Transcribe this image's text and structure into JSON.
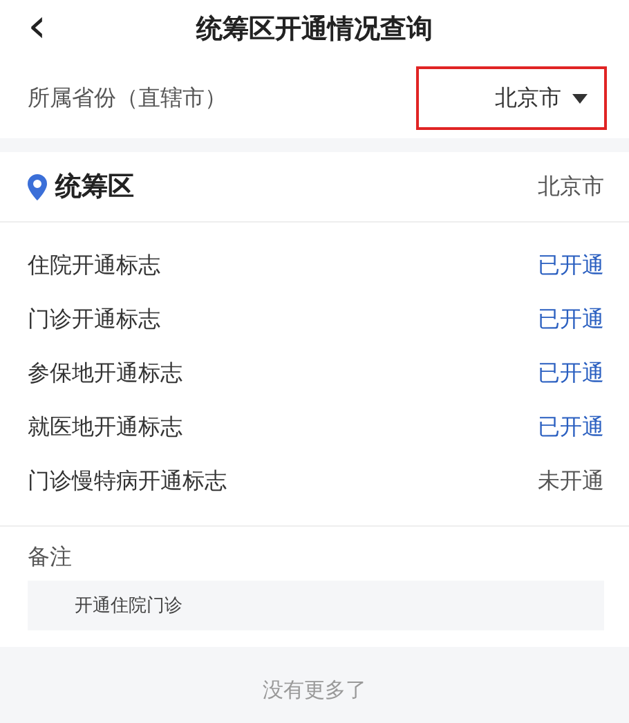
{
  "header": {
    "back": "‹",
    "title": "统筹区开通情况查询"
  },
  "province": {
    "label": "所属省份（直辖市）",
    "value": "北京市",
    "highlighted": true
  },
  "region": {
    "title": "统筹区",
    "value": "北京市"
  },
  "flags": [
    {
      "label": "住院开通标志",
      "status": "已开通",
      "open": true
    },
    {
      "label": "门诊开通标志",
      "status": "已开通",
      "open": true
    },
    {
      "label": "参保地开通标志",
      "status": "已开通",
      "open": true
    },
    {
      "label": "就医地开通标志",
      "status": "已开通",
      "open": true
    },
    {
      "label": "门诊慢特病开通标志",
      "status": "未开通",
      "open": false
    }
  ],
  "remark": {
    "label": "备注",
    "text": "开通住院门诊"
  },
  "footer": "没有更多了"
}
